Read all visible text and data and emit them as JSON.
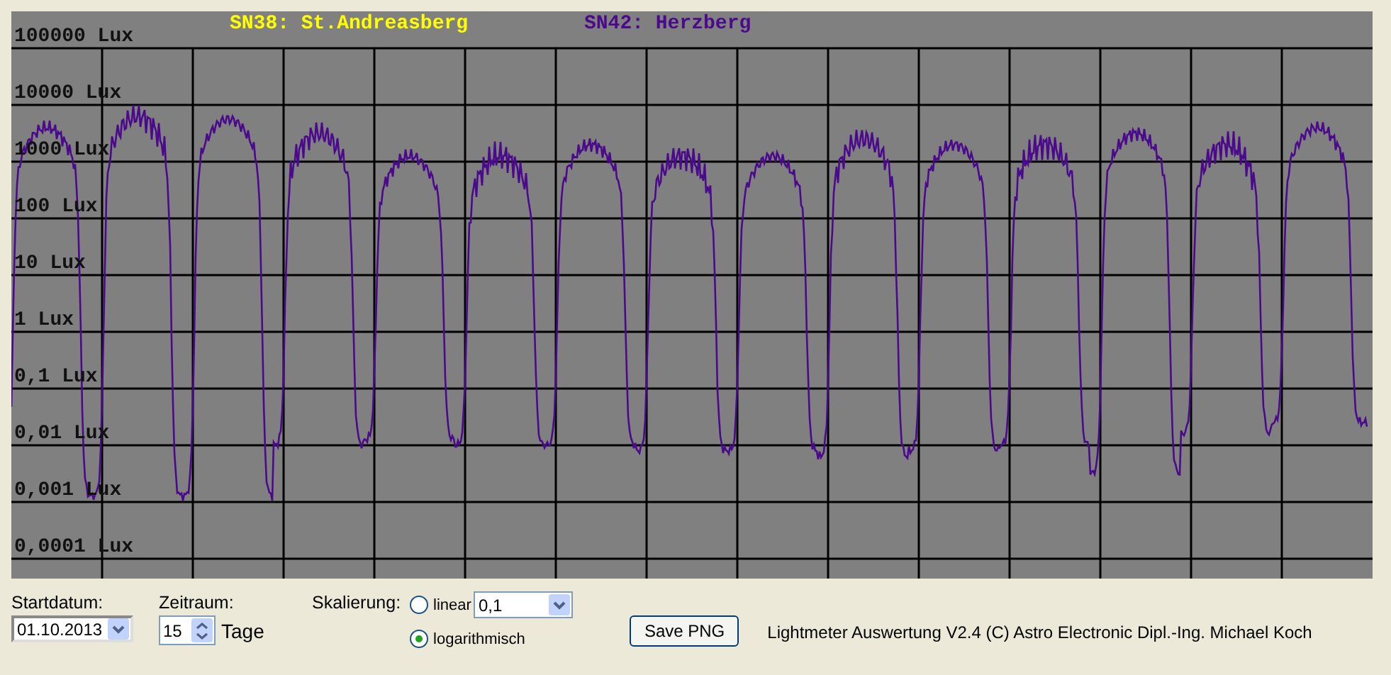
{
  "chart": {
    "legend": [
      {
        "label": "SN38: St.Andreasberg",
        "color": "#ffff00"
      },
      {
        "label": "SN42: Herzberg",
        "color": "#4b0a8c"
      }
    ],
    "y_labels": [
      "100000 Lux",
      "10000 Lux",
      "1000 Lux",
      "100 Lux",
      "10 Lux",
      "1 Lux",
      "0,1 Lux",
      "0,01 Lux",
      "0,001 Lux",
      "0,0001 Lux"
    ]
  },
  "controls": {
    "start_date": {
      "label": "Startdatum:",
      "value": "01.10.2013"
    },
    "period": {
      "label": "Zeitraum:",
      "value": "15",
      "unit": "Tage"
    },
    "scaling": {
      "label": "Skalierung:",
      "options": [
        {
          "label": "linear",
          "selected": false
        },
        {
          "label": "logarithmisch",
          "selected": true
        }
      ],
      "linear_value": "0,1"
    },
    "save_button": "Save PNG",
    "footer": "Lightmeter Auswertung V2.4  (C) Astro Electronic Dipl.-Ing. Michael Koch"
  }
}
